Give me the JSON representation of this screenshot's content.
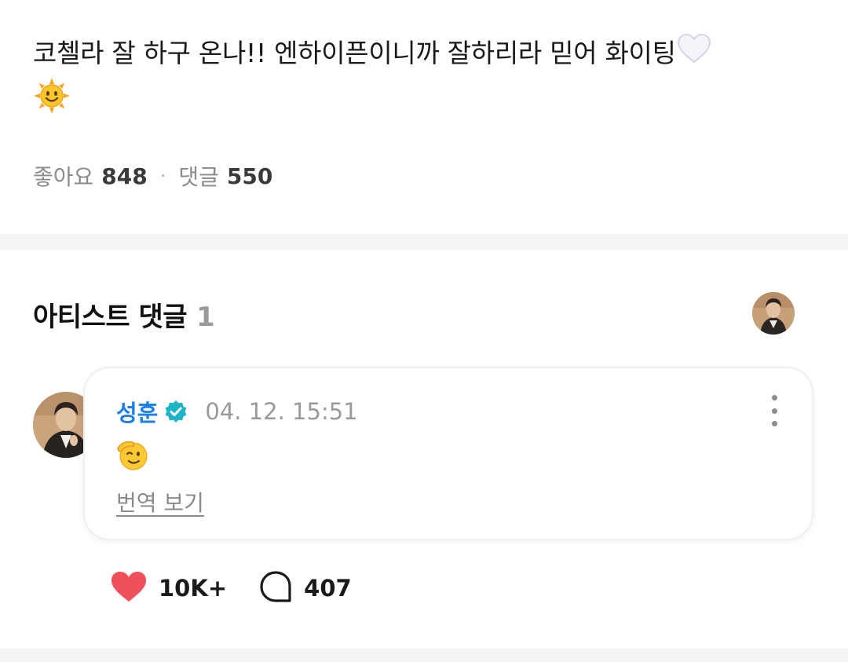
{
  "post": {
    "text": "코첼라 잘 하구 온나!! 엔하이픈이니까 잘하리라 믿어 화이팅",
    "heart_emoji_icon": "white-heart-icon",
    "sun_emoji_icon": "sun-with-face-icon",
    "likes_label": "좋아요",
    "likes_count": "848",
    "comments_label": "댓글",
    "comments_count": "550",
    "separator": "·"
  },
  "artist_comments": {
    "title": "아티스트 댓글",
    "count": "1",
    "comment": {
      "author": "성훈",
      "verified_icon": "verified-badge-icon",
      "timestamp": "04. 12. 15:51",
      "body_emoji_icon": "saluting-face-icon",
      "translate_label": "번역 보기",
      "like_count": "10K+",
      "reply_count": "407"
    }
  },
  "colors": {
    "accent": "#1e7fe6",
    "verified": "#1fb5c9",
    "like_heart": "#f0505a",
    "divider": "#f4f4f4"
  }
}
